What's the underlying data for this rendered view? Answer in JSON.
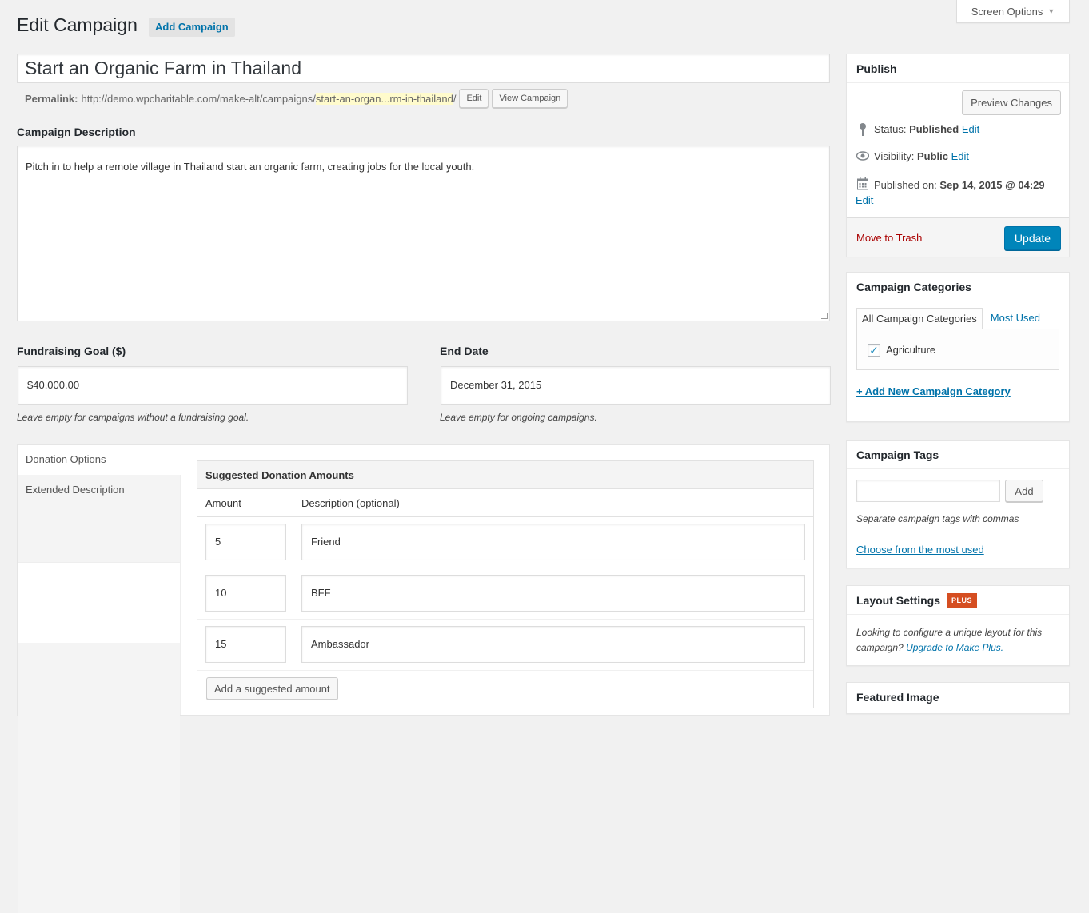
{
  "screen_options": {
    "label": "Screen Options",
    "icon": "triangle-down"
  },
  "header": {
    "title": "Edit Campaign",
    "add_button": "Add Campaign"
  },
  "title_field": {
    "value": "Start an Organic Farm in Thailand"
  },
  "permalink": {
    "label": "Permalink:",
    "base": "http://demo.wpcharitable.com/make-alt/campaigns/",
    "slug": "start-an-organ...rm-in-thailand",
    "trailing": "/",
    "edit_button": "Edit",
    "view_button": "View Campaign"
  },
  "description": {
    "label": "Campaign Description",
    "value": "Pitch in to help a remote village in Thailand start an organic farm, creating jobs for the local youth."
  },
  "goal": {
    "label": "Fundraising Goal ($)",
    "value": "$40,000.00",
    "hint": "Leave empty for campaigns without a fundraising goal."
  },
  "end_date": {
    "label": "End Date",
    "value": "December 31, 2015",
    "hint": "Leave empty for ongoing campaigns."
  },
  "options_panel": {
    "tabs": [
      {
        "label": "Donation Options",
        "active": true
      },
      {
        "label": "Extended Description",
        "active": false
      }
    ],
    "suggested": {
      "title": "Suggested Donation Amounts",
      "columns": [
        "Amount",
        "Description (optional)"
      ],
      "rows": [
        {
          "amount": "5",
          "description": "Friend"
        },
        {
          "amount": "10",
          "description": "BFF"
        },
        {
          "amount": "15",
          "description": "Ambassador"
        }
      ],
      "add_button": "Add a suggested amount"
    }
  },
  "publish": {
    "title": "Publish",
    "preview_button": "Preview Changes",
    "status_label": "Status:",
    "status_value": "Published",
    "visibility_label": "Visibility:",
    "visibility_value": "Public",
    "published_label": "Published on:",
    "published_value": "Sep 14, 2015 @ 04:29",
    "edit_link": "Edit",
    "trash_link": "Move to Trash",
    "update_button": "Update",
    "accent": "#0085ba"
  },
  "categories": {
    "title": "Campaign Categories",
    "tabs": [
      "All Campaign Categories",
      "Most Used"
    ],
    "items": [
      {
        "label": "Agriculture",
        "checked": true
      }
    ],
    "add_link": "+ Add New Campaign Category"
  },
  "tags": {
    "title": "Campaign Tags",
    "input_value": "",
    "add_button": "Add",
    "hint": "Separate campaign tags with commas",
    "choose_link": "Choose from the most used"
  },
  "layout": {
    "title": "Layout Settings",
    "badge": "PLUS",
    "text": "Looking to configure a unique layout for this campaign?",
    "link": "Upgrade to Make Plus."
  },
  "featured_image": {
    "title": "Featured Image"
  }
}
